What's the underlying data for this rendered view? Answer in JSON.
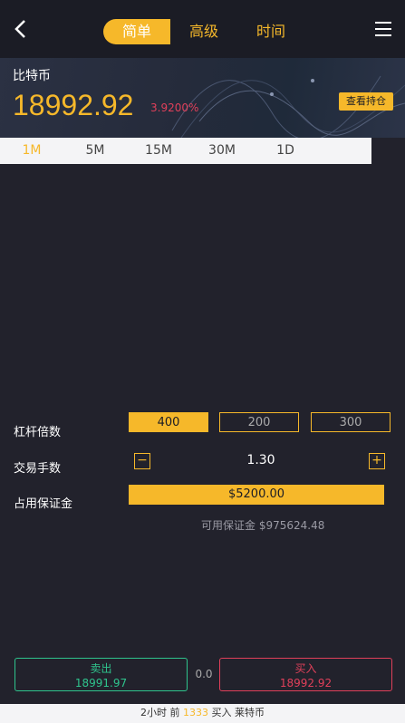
{
  "header": {
    "tabs": [
      {
        "label": "简单",
        "active": true
      },
      {
        "label": "高级",
        "active": false
      },
      {
        "label": "时间",
        "active": false
      }
    ]
  },
  "ticker": {
    "name": "比特币",
    "price": "18992.92",
    "change": "3.9200%",
    "holdings_button": "查看持仓"
  },
  "intervals": [
    {
      "label": "1M",
      "active": true
    },
    {
      "label": "5M",
      "active": false
    },
    {
      "label": "15M",
      "active": false
    },
    {
      "label": "30M",
      "active": false
    },
    {
      "label": "1D",
      "active": false
    }
  ],
  "order": {
    "leverage_label": "杠杆倍数",
    "leverage_options": [
      "400",
      "200",
      "300"
    ],
    "leverage_selected": "400",
    "lots_label": "交易手数",
    "lots_value": "1.30",
    "minus": "−",
    "plus": "+",
    "margin_label": "占用保证金",
    "margin_value": "$5200.00",
    "available": "可用保证金 $975624.48"
  },
  "actions": {
    "sell_label": "卖出",
    "sell_price": "18991.97",
    "spread": "0.0",
    "buy_label": "买入",
    "buy_price": "18992.92"
  },
  "footer": {
    "prefix": "2小时 前",
    "highlight": "1333",
    "suffix": "买入 莱特币"
  },
  "colors": {
    "accent": "#f6b82a",
    "sell": "#2fc48d",
    "buy": "#e0405a",
    "background": "#22222c"
  }
}
